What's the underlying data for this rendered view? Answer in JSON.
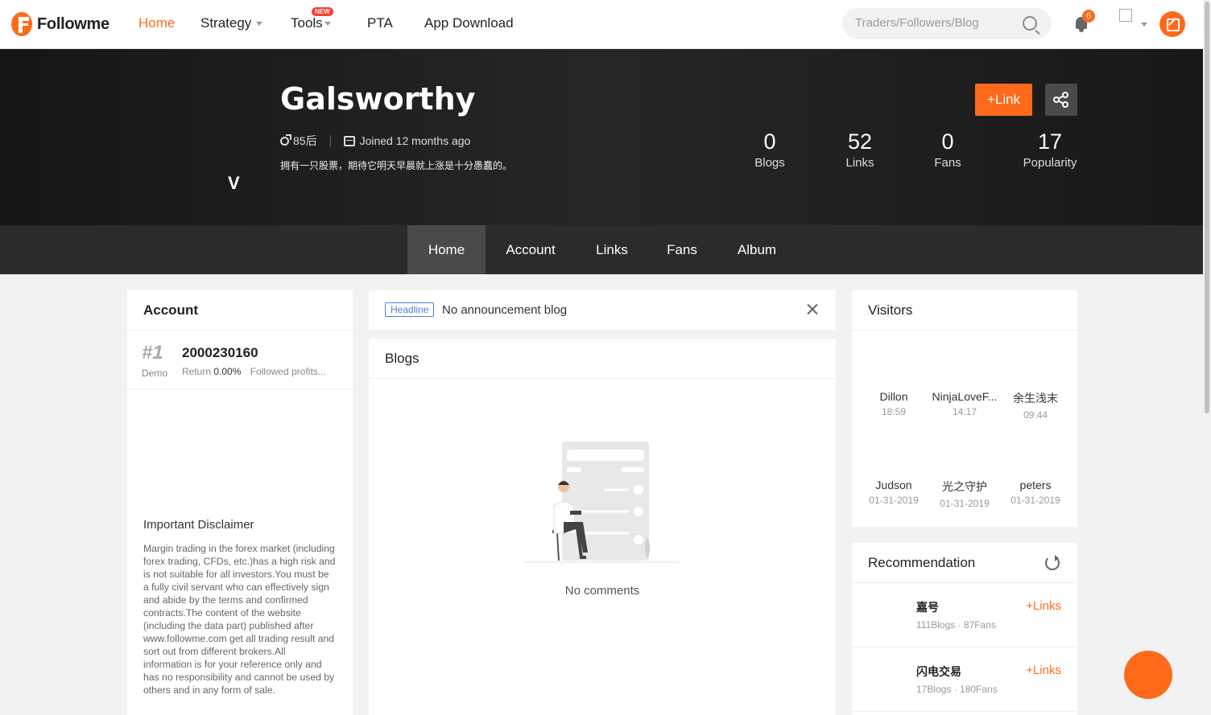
{
  "nav": {
    "logo_text": "Followme",
    "items": [
      {
        "label": "Home"
      },
      {
        "label": "Strategy"
      },
      {
        "label": "Tools",
        "badge": "NEW"
      },
      {
        "label": "PTA"
      },
      {
        "label": "App Download"
      }
    ],
    "search_placeholder": "Traders/Followers/Blog",
    "notification_count": "6",
    "accent_color": "#ff6a1a"
  },
  "profile": {
    "badge_letter": "V",
    "name": "Galsworthy",
    "age_group": "85后",
    "joined": "Joined 12 months ago",
    "bio": "拥有一只股票，期待它明天早晨就上涨是十分愚蠢的。",
    "follow_label": "Link",
    "stats": [
      {
        "value": "0",
        "label": "Blogs"
      },
      {
        "value": "52",
        "label": "Links"
      },
      {
        "value": "0",
        "label": "Fans"
      },
      {
        "value": "17",
        "label": "Popularity"
      }
    ]
  },
  "tabs": [
    {
      "label": "Home"
    },
    {
      "label": "Account"
    },
    {
      "label": "Links"
    },
    {
      "label": "Fans"
    },
    {
      "label": "Album"
    }
  ],
  "account": {
    "title": "Account",
    "rank": "#1",
    "type": "Demo",
    "number": "2000230160",
    "return_label": "Return",
    "return_value": "0.00%",
    "followed_label": "Followed profits...",
    "disclaimer_title": "Important Disclaimer",
    "disclaimer_text": "Margin trading in the forex market (including forex trading, CFDs, etc.)has a high risk and is not suitable for all investors.You must be a fully civil servant who can effectively sign and abide by the terms and confirmed contracts.The content of the website (including the data part) published after www.followme.com get all trading result and sort out from different brokers.All information is for your reference only and has no responsibility and cannot be used by others and in any form of sale."
  },
  "announcement": {
    "badge": "Headline",
    "text": "No announcement blog"
  },
  "blogs": {
    "title": "Blogs",
    "empty_text": "No comments"
  },
  "visitors": {
    "title": "Visitors",
    "items": [
      {
        "name": "Dillon",
        "time": "18:59"
      },
      {
        "name": "NinjaLoveF...",
        "time": "14:17"
      },
      {
        "name": "余生浅末",
        "time": "09:44"
      },
      {
        "name": "Judson",
        "time": "01-31-2019"
      },
      {
        "name": "光之守护",
        "time": "01-31-2019"
      },
      {
        "name": "peters",
        "time": "01-31-2019"
      }
    ]
  },
  "recommendation": {
    "title": "Recommendation",
    "items": [
      {
        "name": "嘉号",
        "stats": "111Blogs · 87Fans",
        "action": "Links"
      },
      {
        "name": "闪电交易",
        "stats": "17Blogs · 180Fans",
        "action": "Links"
      }
    ]
  }
}
